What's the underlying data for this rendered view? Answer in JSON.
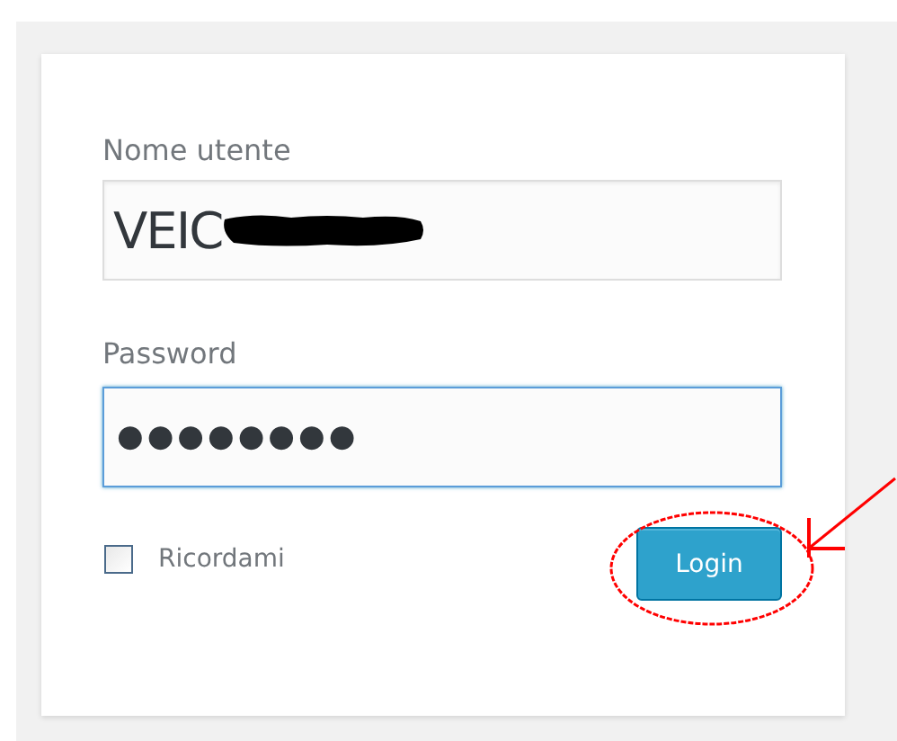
{
  "login_form": {
    "fields": [
      {
        "label": "Nome utente",
        "value": "VEIC",
        "redacted": true,
        "focused": false
      },
      {
        "label": "Password",
        "value": "●●●●●●●●",
        "focused": true
      }
    ],
    "remember": {
      "label": "Ricordami",
      "checked": false
    },
    "button": "Login"
  },
  "annotations": {
    "ellipse": {
      "color": "#ff0000"
    },
    "arrow": {
      "color": "#ff0000"
    }
  }
}
